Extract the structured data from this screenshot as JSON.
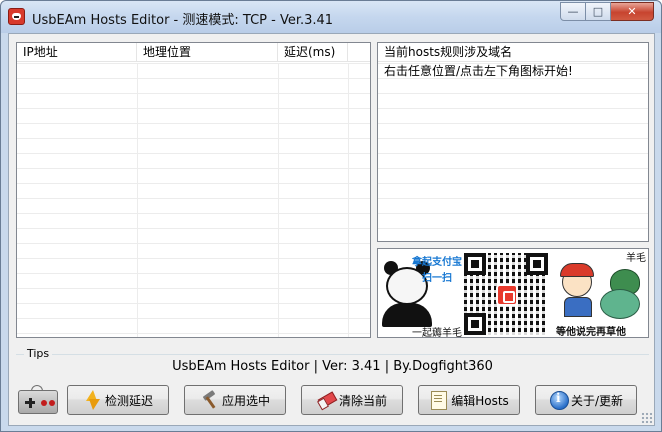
{
  "window": {
    "title": "UsbEAm Hosts Editor - 测速模式: TCP - Ver.3.41",
    "caption_buttons": {
      "minimize": "—",
      "maximize": "□",
      "close": "✕"
    }
  },
  "latency_list": {
    "columns": [
      "IP地址",
      "地理位置",
      "延迟(ms)"
    ],
    "rows": []
  },
  "rules_panel": {
    "header": "当前hosts规则涉及域名",
    "lines": [
      "右击任意位置/点击左下角图标开始!"
    ]
  },
  "banner": {
    "alipay_line1": "拿起支付宝",
    "alipay_line2": "扫一扫",
    "left_caption": "一起薅羊毛",
    "right_tag": "羊毛",
    "right_caption": "等他说完再草他"
  },
  "tips": {
    "label": "Tips",
    "text": "UsbEAm Hosts Editor | Ver: 3.41 | By.Dogfight360"
  },
  "toolbar": {
    "gamepad_icon": "gamepad-icon",
    "buttons": [
      {
        "label": "检测延迟",
        "icon": "lightning-icon"
      },
      {
        "label": "应用选中",
        "icon": "hammer-icon"
      },
      {
        "label": "清除当前",
        "icon": "eraser-icon"
      },
      {
        "label": "编辑Hosts",
        "icon": "notepad-icon"
      },
      {
        "label": "关于/更新",
        "icon": "info-icon"
      }
    ]
  },
  "colors": {
    "window_frame": "#c9d9ec",
    "client_bg": "#f0f0f0",
    "close_button": "#c7442f",
    "alipay_blue": "#1677d2"
  }
}
